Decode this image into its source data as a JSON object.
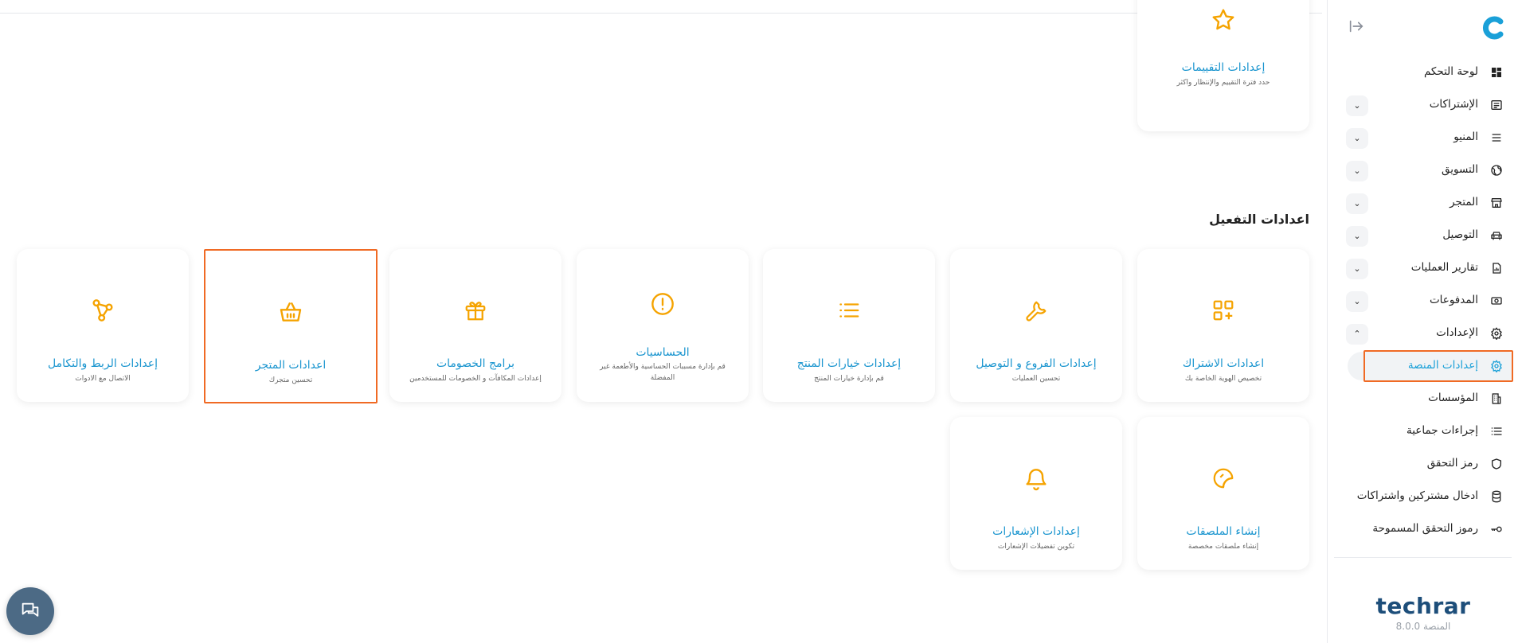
{
  "sidebar": {
    "items": [
      {
        "label": "لوحة التحكم",
        "icon": "dashboard-icon",
        "expandable": false
      },
      {
        "label": "الإشتراكات",
        "icon": "subscriptions-icon",
        "expandable": true
      },
      {
        "label": "المنيو",
        "icon": "menu-icon",
        "expandable": true
      },
      {
        "label": "التسويق",
        "icon": "globe-icon",
        "expandable": true
      },
      {
        "label": "المتجر",
        "icon": "store-icon",
        "expandable": true
      },
      {
        "label": "التوصيل",
        "icon": "car-icon",
        "expandable": true
      },
      {
        "label": "تقارير العمليات",
        "icon": "report-icon",
        "expandable": true
      },
      {
        "label": "المدفوعات",
        "icon": "payments-icon",
        "expandable": true
      },
      {
        "label": "الإعدادات",
        "icon": "gear-icon",
        "expandable": true,
        "expanded": true
      },
      {
        "label": "إعدادات المنصة",
        "icon": "gear-icon",
        "active": true
      },
      {
        "label": "المؤسسات",
        "icon": "building-icon"
      },
      {
        "label": "إجراءات جماعية",
        "icon": "list-icon"
      },
      {
        "label": "رمز التحقق",
        "icon": "shield-icon"
      },
      {
        "label": "ادخال مشتركين واشتراكات",
        "icon": "database-icon"
      },
      {
        "label": "رموز التحقق المسموحة",
        "icon": "key-icon"
      }
    ],
    "brand": "techrar",
    "version": "المنصة 8.0.0"
  },
  "top_card": {
    "title": "إعدادات التقييمات",
    "desc": "حدد فترة التقييم والإنتظار واكثر",
    "icon": "star-icon"
  },
  "section_title": "اعدادات التفعيل",
  "cards_row1": [
    {
      "title": "اعدادات الاشتراك",
      "desc": "تخصيص الهوية الخاصة بك",
      "icon": "grid-plus-icon"
    },
    {
      "title": "إعدادات الفروع و التوصيل",
      "desc": "تحسين العمليات",
      "icon": "wrench-icon"
    },
    {
      "title": "إعدادات خيارات المنتج",
      "desc": "قم بإدارة خيارات المنتج",
      "icon": "list-icon"
    },
    {
      "title": "الحساسيات",
      "desc": "قم بإدارة مسببات الحساسية والأطعمة غير المفضلة",
      "icon": "alert-circle-icon"
    },
    {
      "title": "برامج الخصومات",
      "desc": "إعدادات المكافآت و الخصومات للمستخدمين",
      "icon": "gift-icon"
    },
    {
      "title": "اعدادات المتجر",
      "desc": "تحسين متجرك",
      "icon": "basket-icon",
      "selected": true
    },
    {
      "title": "إعدادات الربط والتكامل",
      "desc": "الاتصال مع الادوات",
      "icon": "integration-icon"
    }
  ],
  "cards_row2": [
    {
      "title": "إنشاء الملصقات",
      "desc": "إنشاء ملصقات مخصصة",
      "icon": "sticker-icon"
    },
    {
      "title": "إعدادات الإشعارات",
      "desc": "تكوين تفضيلات الإشعارات",
      "icon": "bell-icon"
    }
  ],
  "colors": {
    "accent": "#1a95cf",
    "icon": "#f5a300",
    "highlight": "#f06a24",
    "brand": "#1d4e7a"
  }
}
